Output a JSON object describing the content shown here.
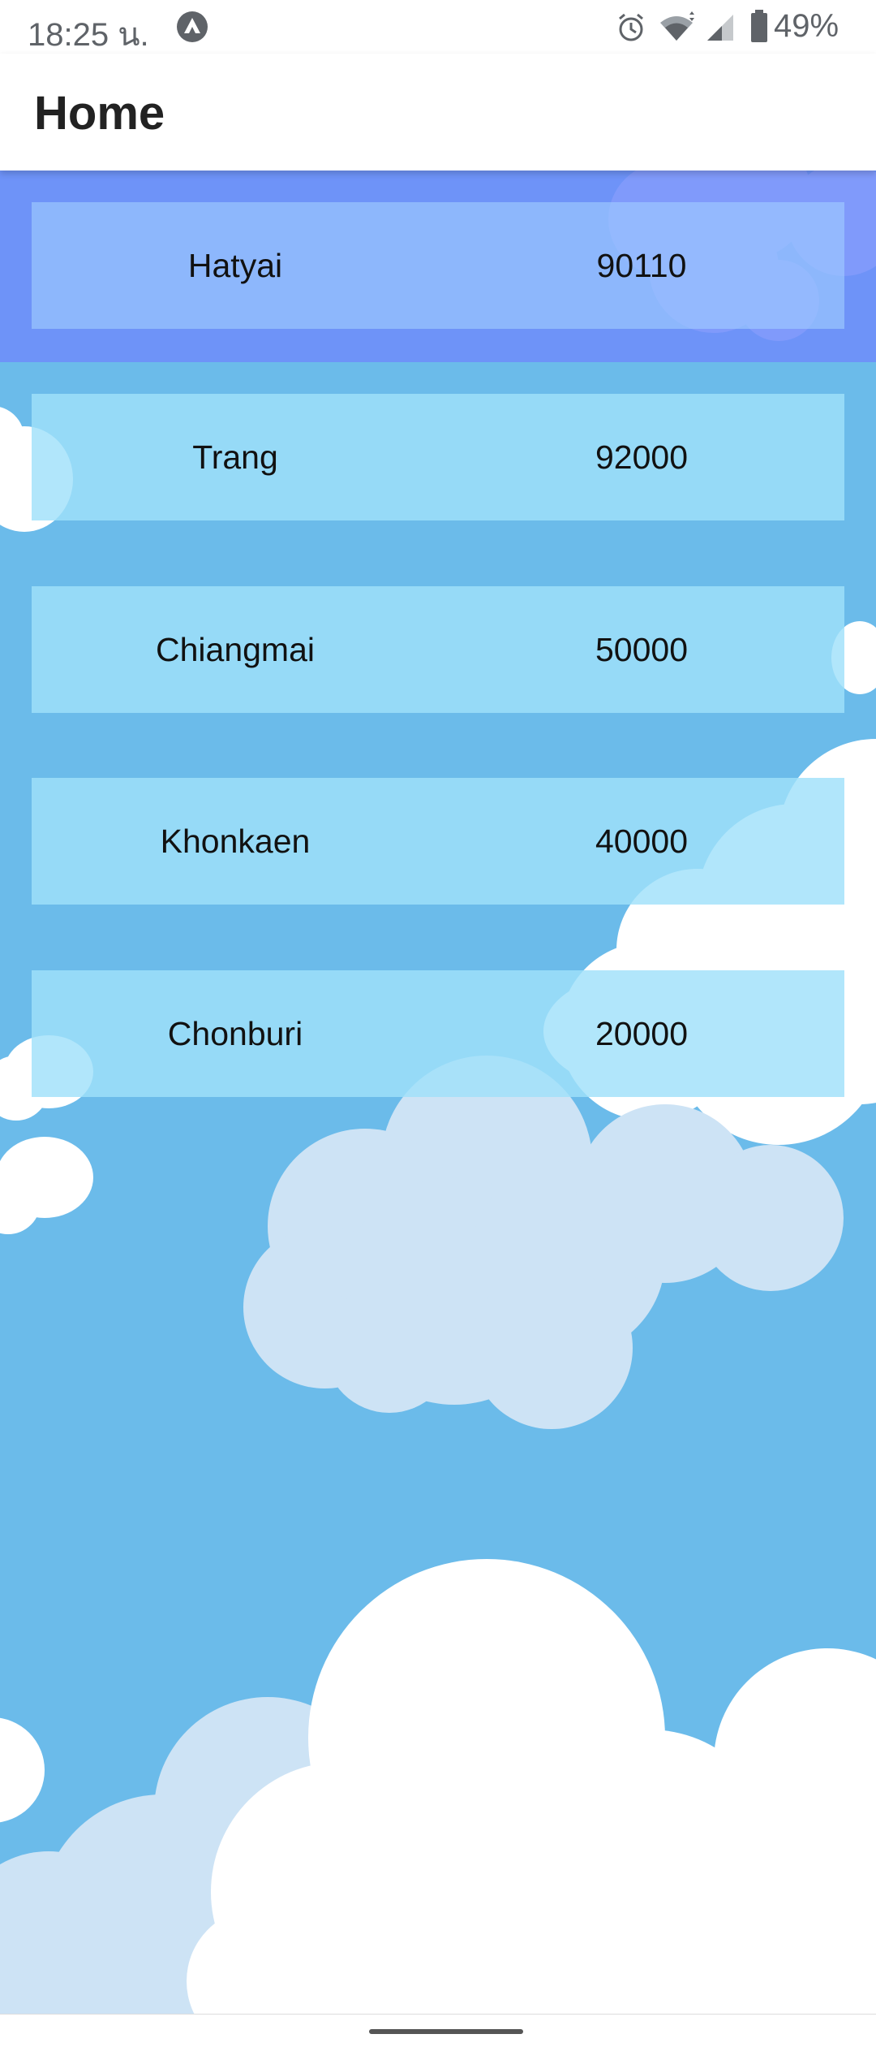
{
  "status_bar": {
    "time": "18:25 น.",
    "battery": "49%",
    "icons": [
      "app-notification-icon",
      "alarm-icon",
      "wifi-icon",
      "signal-icon",
      "battery-icon"
    ]
  },
  "app_bar": {
    "title": "Home"
  },
  "list": {
    "rows": [
      {
        "city": "Hatyai",
        "zip": "90110",
        "selected": true
      },
      {
        "city": "Trang",
        "zip": "92000",
        "selected": false
      },
      {
        "city": "Chiangmai",
        "zip": "50000",
        "selected": false
      },
      {
        "city": "Khonkaen",
        "zip": "40000",
        "selected": false
      },
      {
        "city": "Chonburi",
        "zip": "20000",
        "selected": false
      }
    ]
  },
  "colors": {
    "sky": "#6bbbea",
    "selected_band": "#6e8cfa",
    "row": "#a0e1fa",
    "cloud": "#ffffff",
    "cloud_shadow": "#cde3f5"
  }
}
